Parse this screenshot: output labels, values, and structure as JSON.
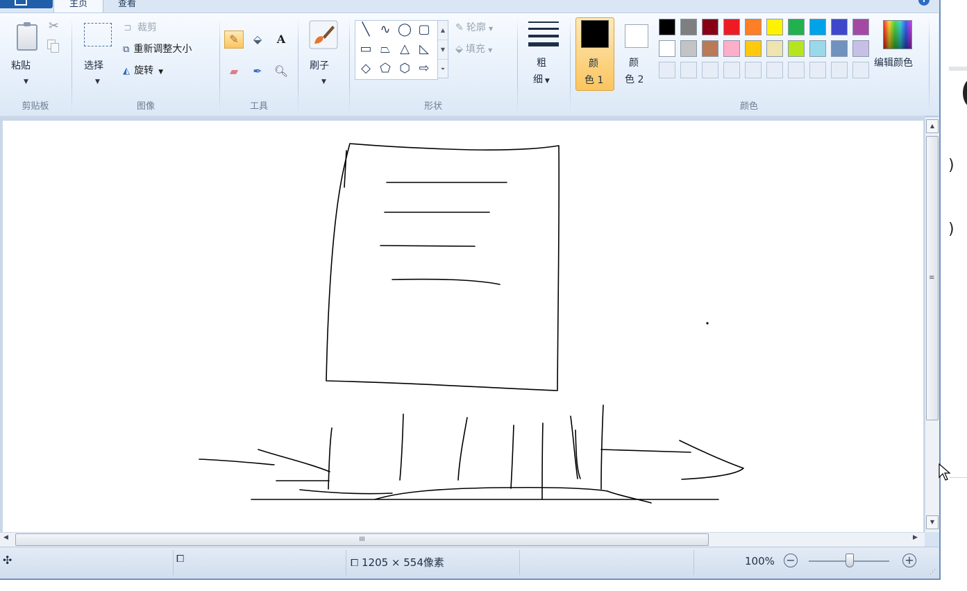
{
  "tabs": {
    "home": "主页",
    "view": "查看"
  },
  "help_icon": "help-icon",
  "groups": {
    "clipboard": {
      "label": "剪贴板",
      "paste": "粘贴",
      "cut_icon": "scissors-icon",
      "copy_icon": "copy-icon"
    },
    "image": {
      "label": "图像",
      "select": "选择",
      "crop": "裁剪",
      "resize": "重新调整大小",
      "rotate": "旋转"
    },
    "tools": {
      "label": "工具",
      "pencil_icon": "pencil-icon",
      "fill_icon": "fill-bucket-icon",
      "text_icon": "A",
      "eraser_icon": "eraser-icon",
      "picker_icon": "color-picker-icon",
      "magnifier_icon": "magnifier-icon"
    },
    "brushes": {
      "label": "刷子"
    },
    "shapes": {
      "label": "形状",
      "outline": "轮廓",
      "fill": "填充",
      "items": [
        "╲",
        "∿",
        "◯",
        "▢",
        "▭",
        "⏢",
        "△",
        "◺",
        "◇",
        "⬠",
        "⬡",
        "⇨"
      ]
    },
    "size": {
      "label_line1": "粗",
      "label_line2": "细"
    },
    "colors": {
      "label": "颜色",
      "color1_line1": "颜",
      "color1_line2": "色 1",
      "color2_line1": "颜",
      "color2_line2": "色 2",
      "color1_value": "#000000",
      "color2_value": "#ffffff",
      "edit_colors": "编辑颜色",
      "palette_row1": [
        "#000000",
        "#7f7f7f",
        "#880015",
        "#ed1c24",
        "#ff7f27",
        "#fff200",
        "#22b14c",
        "#00a2e8",
        "#3f48cc",
        "#a349a4"
      ],
      "palette_row2": [
        "#ffffff",
        "#c3c3c3",
        "#b97a57",
        "#ffaec9",
        "#ffc90e",
        "#efe4b0",
        "#b5e61d",
        "#99d9ea",
        "#7092be",
        "#c8bfe7"
      ]
    }
  },
  "scrollbar": {
    "h_grip": "III",
    "v_grip": "≡"
  },
  "status": {
    "move_icon": "move-cursor-icon",
    "selection_icon": "selection-size-icon",
    "canvas_size_icon": "canvas-size-icon",
    "canvas_size": "1205 × 554像素",
    "zoom": "100%"
  },
  "background_window": {
    "text1": ")",
    "text2": ")"
  }
}
